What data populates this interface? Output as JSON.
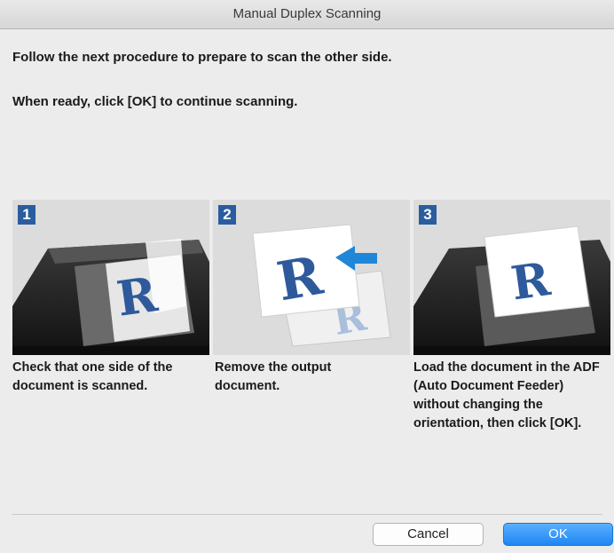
{
  "window": {
    "title": "Manual Duplex Scanning"
  },
  "instructions": {
    "line1": "Follow the next procedure to prepare to scan the other side.",
    "line2": "When ready, click [OK] to continue scanning."
  },
  "steps": [
    {
      "number": "1",
      "text": "Check that one side of the document is scanned."
    },
    {
      "number": "2",
      "text": "Remove the output document."
    },
    {
      "number": "3",
      "text": "Load the document in the ADF (Auto Document Feeder) without changing the orientation, then click [OK]."
    }
  ],
  "buttons": {
    "cancel": "Cancel",
    "ok": "OK"
  },
  "colors": {
    "accent": "#2a5d9f",
    "ok_button": "#1f86f2"
  }
}
